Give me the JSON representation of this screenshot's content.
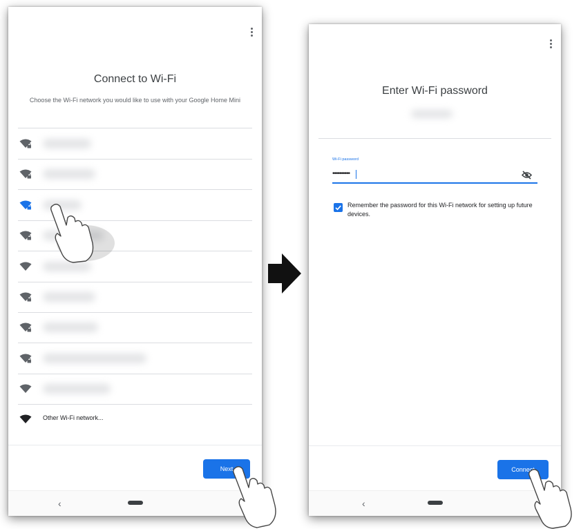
{
  "left_screen": {
    "title": "Connect to Wi-Fi",
    "subtitle": "Choose the Wi-Fi network you would like to use with your Google Home Mini",
    "networks": [
      {
        "icon": "wifi-lock-icon",
        "selected": false
      },
      {
        "icon": "wifi-lock-icon",
        "selected": false
      },
      {
        "icon": "wifi-lock-icon",
        "selected": true
      },
      {
        "icon": "wifi-lock-icon",
        "selected": false
      },
      {
        "icon": "wifi-icon",
        "selected": false
      },
      {
        "icon": "wifi-lock-icon",
        "selected": false
      },
      {
        "icon": "wifi-lock-icon",
        "selected": false
      },
      {
        "icon": "wifi-lock-icon",
        "selected": false
      },
      {
        "icon": "wifi-icon",
        "selected": false
      }
    ],
    "other_network_label": "Other Wi-Fi network...",
    "next_button": "Next"
  },
  "right_screen": {
    "title": "Enter Wi-Fi password",
    "password_label": "Wi-Fi password",
    "password_value": "••••••••••",
    "remember_checked": true,
    "remember_text": "Remember the password for this Wi-Fi network for setting up future devices.",
    "connect_button": "Connect"
  },
  "navbar": {
    "back_glyph": "‹"
  },
  "colors": {
    "accent": "#1a73e8",
    "icon_gray": "#5f6368",
    "divider": "#dadce0"
  }
}
